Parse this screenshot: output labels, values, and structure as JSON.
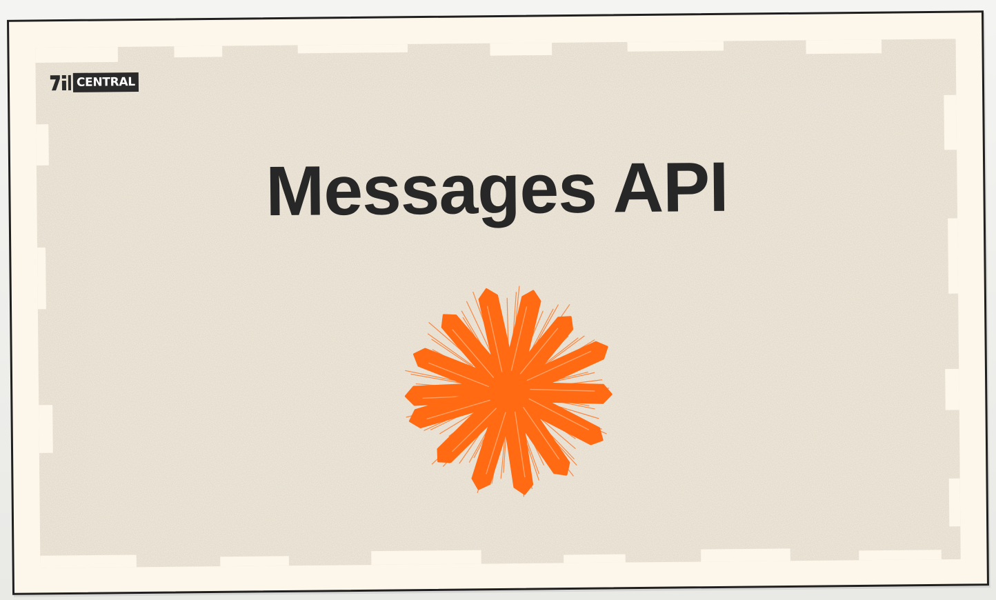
{
  "logo": {
    "mark_icon": "ai-mark-icon",
    "text": "CENTRAL"
  },
  "title": "Messages API",
  "illustration": {
    "icon": "orange-starburst-icon",
    "color": "#ff6a13"
  },
  "colors": {
    "card_background": "#fdf6ea",
    "texture": "#e6ddcd",
    "title": "#272727",
    "logo_background": "#2a2a2a",
    "accent": "#ff6a13"
  }
}
